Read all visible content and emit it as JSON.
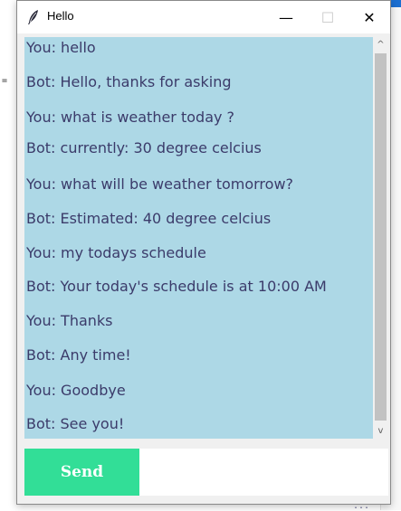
{
  "window": {
    "title": "Hello",
    "minimize_glyph": "—",
    "maximize_glyph": "☐",
    "close_glyph": "✕"
  },
  "chat": {
    "messages": [
      "You: hello",
      "Bot: Hello, thanks for asking",
      "You: what is weather today ?",
      "Bot: currently: 30 degree celcius",
      "You: what will be weather tomorrow?",
      "Bot: Estimated: 40 degree celcius",
      "You: my todays schedule",
      "Bot: Your today's schedule is at 10:00 AM",
      "You: Thanks",
      "Bot: Any time!",
      "You: Goodbye",
      "Bot: See you!"
    ],
    "background_color": "#add8e6",
    "text_color": "#3b3b6a"
  },
  "scrollbar": {
    "up_glyph": "^",
    "down_glyph": "v"
  },
  "input": {
    "send_label": "Send",
    "send_color": "#32de97",
    "value": ""
  }
}
